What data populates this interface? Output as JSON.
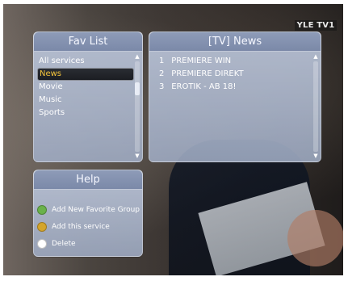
{
  "channel_logo": "YLE TV1",
  "fav_panel": {
    "title": "Fav List",
    "items": [
      {
        "label": "All services"
      },
      {
        "label": "News",
        "selected": true
      },
      {
        "label": "Movie"
      },
      {
        "label": "Music"
      },
      {
        "label": "Sports"
      }
    ]
  },
  "service_panel": {
    "title": "[TV]  News",
    "items": [
      {
        "number": "1",
        "name": "PREMIERE WIN"
      },
      {
        "number": "2",
        "name": "PREMIERE DIREKT"
      },
      {
        "number": "3",
        "name": "EROTIK - AB 18!"
      }
    ]
  },
  "help_panel": {
    "title": "Help",
    "items": [
      {
        "label": "Add New Favorite Group",
        "button_color": "#6ab24a",
        "button_name": "green-button-icon"
      },
      {
        "label": "Add this service",
        "button_color": "#d4a52c",
        "button_name": "yellow-button-icon"
      },
      {
        "label": "Delete",
        "button_color": "#ffffff",
        "button_name": "white-button-icon"
      }
    ]
  },
  "colors": {
    "selected_text": "#f2c23a",
    "panel": "#b4bfd6"
  }
}
